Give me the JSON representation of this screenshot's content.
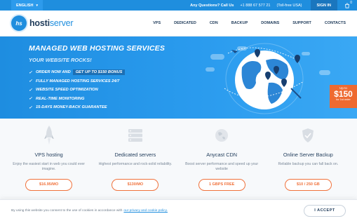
{
  "topbar": {
    "language": "ENGLISH",
    "question": "Any Questions? Call Us",
    "phone": "+1 888 67 577 21",
    "tollfree": "(Toll-free USA)",
    "signin": "SIGN IN",
    "cart_icon": "cart-icon",
    "cart_badge": "0"
  },
  "brand": {
    "logo_mark": "hs",
    "name_bold": "hosti",
    "name_light": "server"
  },
  "nav": [
    "VPS",
    "DEDICATED",
    "CDN",
    "BACKUP",
    "DOMAINS",
    "SUPPORT",
    "CONTACTS"
  ],
  "hero": {
    "title": "MANAGED WEB HOSTING SERVICES",
    "subtitle": "YOUR WEBSITE ROCKS!",
    "bullets": [
      {
        "text": "ORDER NOW AND",
        "highlight": "GET UP TO $150 BONUS"
      },
      {
        "text": "FULLY MANAGED HOSTING SERVICES 24/7",
        "highlight": ""
      },
      {
        "text": "WEBSITE SPEED OPTIMIZATION",
        "highlight": ""
      },
      {
        "text": "REAL-TIME MONITORING",
        "highlight": ""
      },
      {
        "text": "15-DAYS MONEY-BACK GUARANTEE",
        "highlight": ""
      }
    ],
    "ribbon": {
      "upto": "Up to",
      "amount": "$150",
      "first": "for 1st order"
    }
  },
  "features": [
    {
      "icon": "rocket-icon",
      "title": "VPS hosting",
      "desc": "Enjoy the easiest start in web you could ever imagine.",
      "button": "$16.95/MO"
    },
    {
      "icon": "server-icon",
      "title": "Dedicated servers",
      "desc": "Highest performance and rock-solid reliability.",
      "button": "$130/MO"
    },
    {
      "icon": "globe-icon",
      "title": "Anycast CDN",
      "desc": "Boost server performance and speed up your website",
      "button": "1 GBPS FREE"
    },
    {
      "icon": "shield-icon",
      "title": "Online Server Backup",
      "desc": "Reliable backup you can fall back on.",
      "button": "$10 / 250 GB"
    }
  ],
  "cookie": {
    "text": "By using this website you consent to the use of cookies in accordance with",
    "link": "our privacy and cookie policy.",
    "accept": "I ACCEPT"
  },
  "colors": {
    "primary": "#1f8ede",
    "accent": "#f0723c",
    "dark": "#1f3b5a"
  }
}
